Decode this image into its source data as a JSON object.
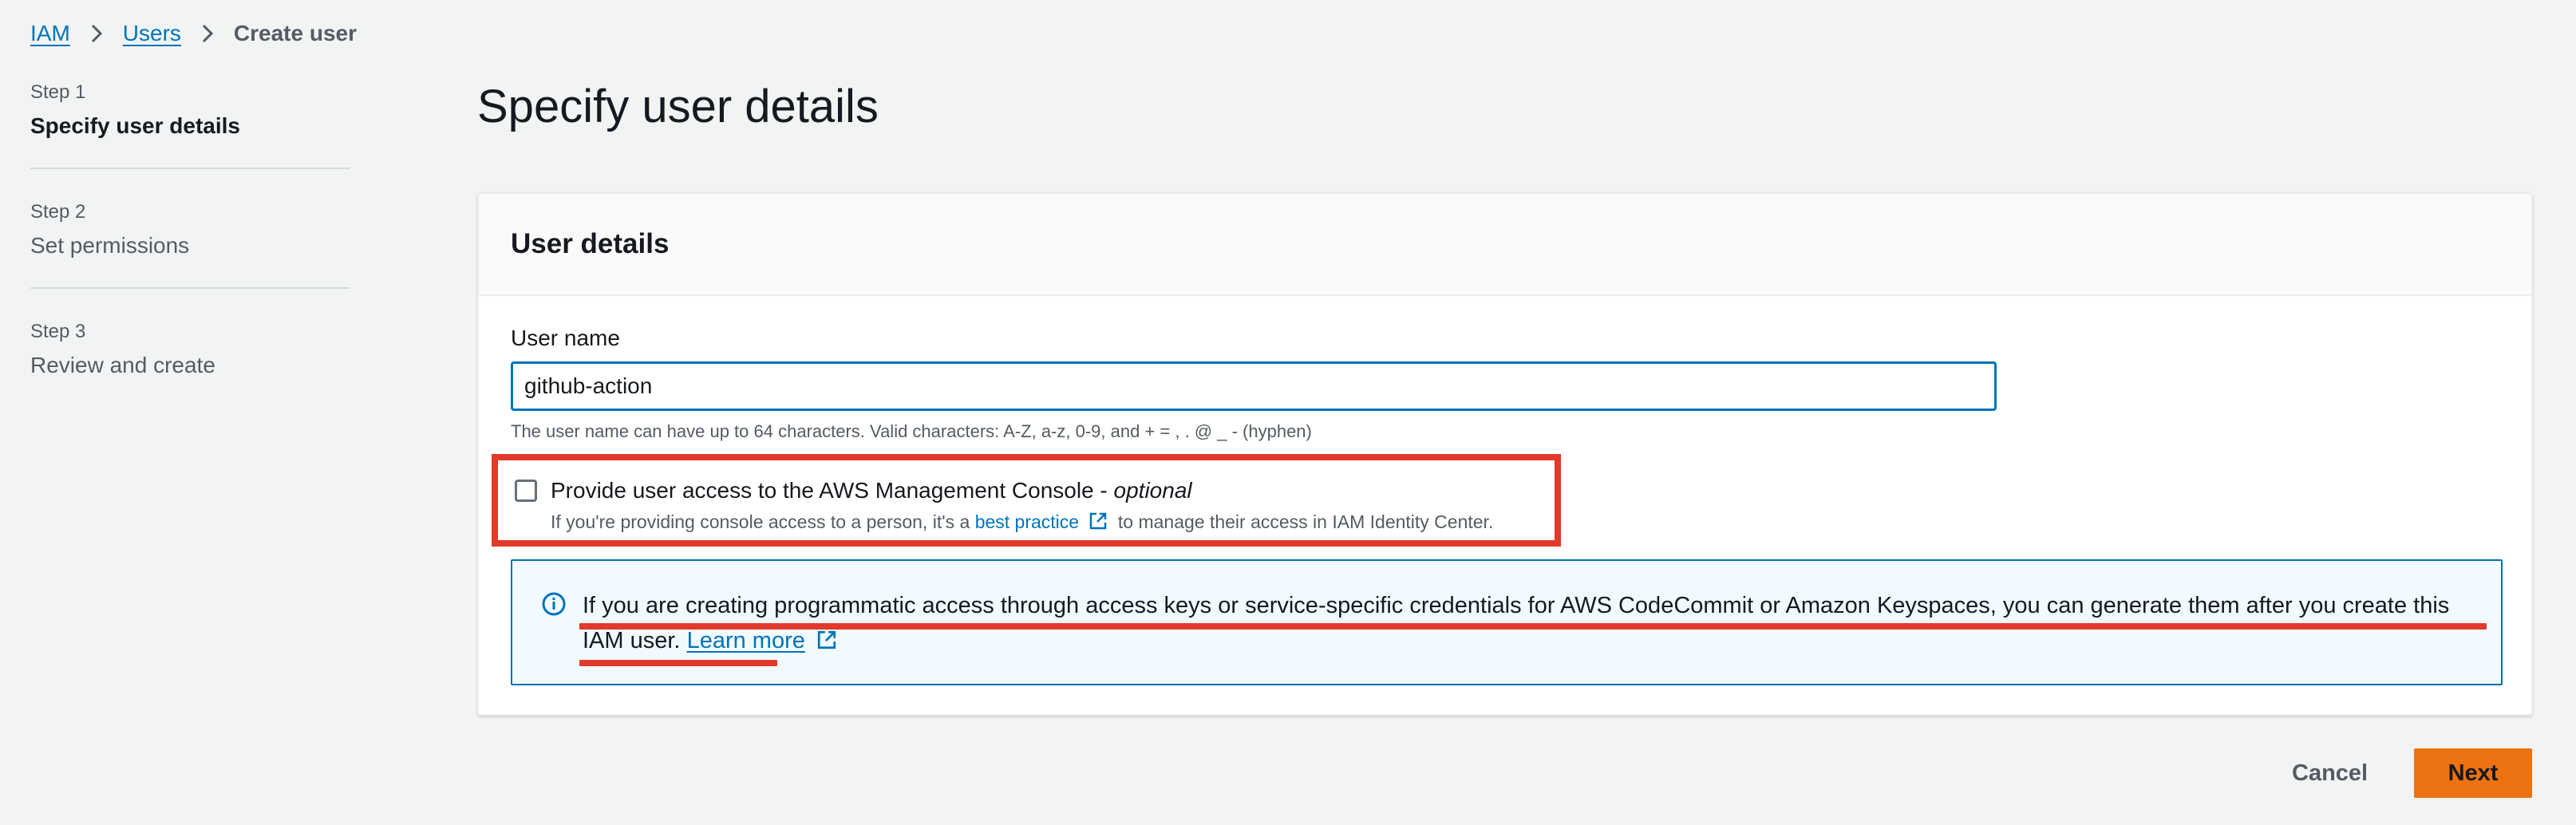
{
  "breadcrumb": {
    "items": [
      "IAM",
      "Users"
    ],
    "current": "Create user"
  },
  "steps": [
    {
      "label": "Step 1",
      "title": "Specify user details"
    },
    {
      "label": "Step 2",
      "title": "Set permissions"
    },
    {
      "label": "Step 3",
      "title": "Review and create"
    }
  ],
  "page": {
    "title": "Specify user details"
  },
  "user_details": {
    "header": "User details",
    "username_label": "User name",
    "username_value": "github-action",
    "username_hint": "The user name can have up to 64 characters. Valid characters: A-Z, a-z, 0-9, and + = , . @ _ - (hyphen)",
    "console_access_label": "Provide user access to the AWS Management Console - ",
    "console_access_optional": "optional",
    "console_access_checked": false,
    "console_desc_prefix": "If you're providing console access to a person, it's a",
    "console_desc_link": "best practice",
    "console_desc_suffix": "to manage their access in IAM Identity Center.",
    "info_text": "If you are creating programmatic access through access keys or service-specific credentials for AWS CodeCommit or Amazon Keyspaces, you can generate them after you create this IAM user.",
    "info_link": "Learn more"
  },
  "footer": {
    "cancel_label": "Cancel",
    "next_label": "Next"
  },
  "colors": {
    "link": "#0073bb",
    "primary_button": "#ec7211",
    "annotation_red": "#e23a2a",
    "info_background": "#f1faff"
  },
  "icons": {
    "breadcrumb_separator": "chevron-right-icon",
    "external_link": "external-link-icon",
    "info": "info-circle-icon"
  }
}
